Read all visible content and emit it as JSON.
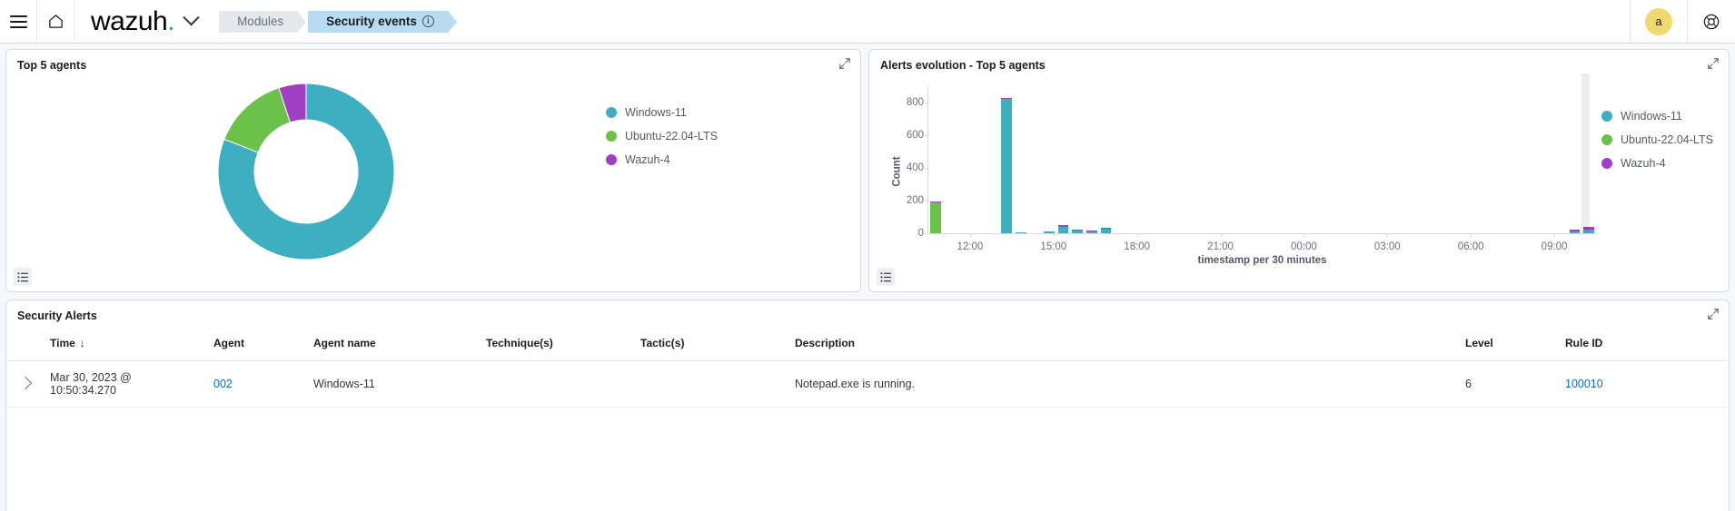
{
  "header": {
    "menu_icon": "hamburger-menu-icon",
    "home_icon": "home-icon",
    "logo_text": "wazuh",
    "logo_dot": ".",
    "space_chevron_icon": "chevron-down-icon",
    "breadcrumbs": [
      {
        "label": "Modules",
        "active": false
      },
      {
        "label": "Security events",
        "active": true,
        "info": true
      }
    ],
    "avatar_initial": "a",
    "help_icon": "help-lifebuoy-icon"
  },
  "panels": {
    "agents": {
      "title": "Top 5 agents",
      "expand_icon": "expand-icon",
      "inspect_icon": "inspect-list-icon"
    },
    "evolution": {
      "title": "Alerts evolution - Top 5 agents",
      "expand_icon": "expand-icon",
      "inspect_icon": "inspect-list-icon"
    },
    "alerts": {
      "title": "Security Alerts",
      "expand_icon": "expand-icon"
    }
  },
  "colors": {
    "windows": "#3eafc0",
    "ubuntu": "#6bc24a",
    "wazuh": "#a13fc4",
    "link": "#0071c2",
    "avatar": "#f1d86f"
  },
  "chart_data": [
    {
      "type": "pie",
      "variant": "donut",
      "title": "Top 5 agents",
      "legend_position": "right",
      "labels": [
        "Windows-11",
        "Ubuntu-22.04-LTS",
        "Wazuh-4"
      ],
      "values": [
        81,
        14,
        5
      ],
      "colors": [
        "#3eafc0",
        "#6bc24a",
        "#a13fc4"
      ]
    },
    {
      "type": "bar",
      "variant": "stacked",
      "title": "Alerts evolution - Top 5 agents",
      "xlabel": "timestamp per 30 minutes",
      "ylabel": "Count",
      "ylim": [
        0,
        900
      ],
      "yticks": [
        0,
        200,
        400,
        600,
        800
      ],
      "xticks": [
        "12:00",
        "15:00",
        "18:00",
        "21:00",
        "00:00",
        "03:00",
        "06:00",
        "09:00"
      ],
      "grid": false,
      "legend_position": "right",
      "series": [
        {
          "name": "Windows-11",
          "color": "#3eafc0",
          "values": [
            0,
            0,
            0,
            0,
            0,
            820,
            8,
            0,
            10,
            38,
            18,
            10,
            26,
            0,
            0,
            0,
            0,
            0,
            0,
            0,
            0,
            0,
            0,
            0,
            0,
            0,
            0,
            0,
            0,
            0,
            0,
            0,
            0,
            0,
            0,
            0,
            0,
            0,
            0,
            0,
            0,
            0,
            0,
            0,
            0,
            14,
            22
          ]
        },
        {
          "name": "Ubuntu-22.04-LTS",
          "color": "#6bc24a",
          "values": [
            188,
            0,
            0,
            0,
            0,
            0,
            0,
            0,
            0,
            0,
            0,
            0,
            0,
            0,
            0,
            0,
            0,
            0,
            0,
            0,
            0,
            0,
            0,
            0,
            0,
            0,
            0,
            0,
            0,
            0,
            0,
            0,
            0,
            0,
            0,
            0,
            0,
            0,
            0,
            0,
            0,
            0,
            0,
            0,
            0,
            0,
            0
          ]
        },
        {
          "name": "Wazuh-4",
          "color": "#a13fc4",
          "values": [
            8,
            0,
            0,
            0,
            0,
            10,
            0,
            0,
            0,
            12,
            5,
            4,
            8,
            0,
            0,
            0,
            0,
            0,
            0,
            0,
            0,
            0,
            0,
            0,
            0,
            0,
            0,
            0,
            0,
            0,
            0,
            0,
            0,
            0,
            0,
            0,
            0,
            0,
            0,
            0,
            0,
            0,
            0,
            0,
            0,
            9,
            18
          ]
        }
      ]
    }
  ],
  "table": {
    "columns": [
      {
        "key": "time",
        "label": "Time",
        "sorted": "desc",
        "sort_arrow": "↓"
      },
      {
        "key": "agent",
        "label": "Agent"
      },
      {
        "key": "agent_name",
        "label": "Agent name"
      },
      {
        "key": "techniques",
        "label": "Technique(s)"
      },
      {
        "key": "tactics",
        "label": "Tactic(s)"
      },
      {
        "key": "description",
        "label": "Description"
      },
      {
        "key": "level",
        "label": "Level"
      },
      {
        "key": "rule_id",
        "label": "Rule ID"
      }
    ],
    "rows": [
      {
        "time": "Mar 30, 2023 @ 10:50:34.270",
        "time_line1": "Mar 30, 2023 @",
        "time_line2": "10:50:34.270",
        "agent": "002",
        "agent_name": "Windows-11",
        "techniques": "",
        "tactics": "",
        "description": "Notepad.exe is running.",
        "level": "6",
        "rule_id": "100010"
      }
    ]
  }
}
